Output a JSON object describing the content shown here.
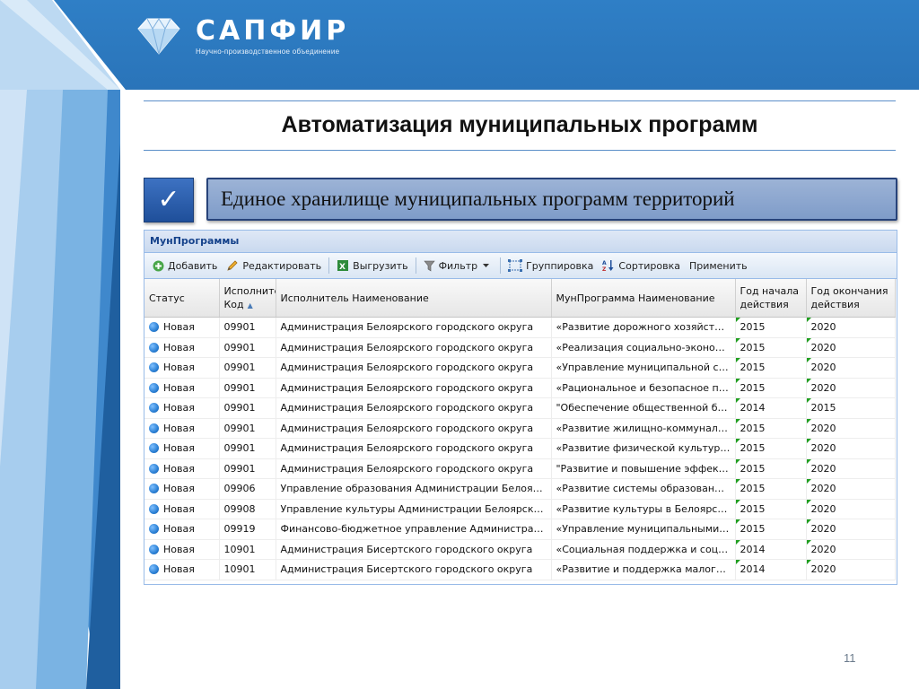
{
  "brand": {
    "name": "САПФИР",
    "subtitle": "Научно-производственное объединение"
  },
  "colors": {
    "header_blue": "#2f7fc6",
    "banner_fill": "#8fa8d0",
    "check_fill": "#2b5cab",
    "grid_header_text": "#15428b"
  },
  "slide": {
    "title": "Автоматизация муниципальных программ",
    "check_mark": "✓",
    "banner_text": "Единое хранилище муниципальных программ территорий",
    "page_number": "11"
  },
  "grid": {
    "panel_title": "МунПрограммы",
    "toolbar": {
      "add": "Добавить",
      "edit": "Редактировать",
      "export": "Выгрузить",
      "filter": "Фильтр",
      "group": "Группировка",
      "sort": "Сортировка",
      "apply": "Применить"
    },
    "columns": {
      "status": "Статус",
      "code_line1": "Исполните",
      "code_line2": "Код",
      "executor_name": "Исполнитель Наименование",
      "program_name": "МунПрограмма Наименование",
      "start_line1": "Год начала",
      "start_line2": "действия",
      "end_line1": "Год окончания",
      "end_line2": "действия"
    },
    "rows": [
      {
        "status": "Новая",
        "code": "09901",
        "executor": "Администрация Белоярского городского округа",
        "program": "«Развитие дорожного хозяйства ...",
        "start": "2015",
        "end": "2020"
      },
      {
        "status": "Новая",
        "code": "09901",
        "executor": "Администрация Белоярского городского округа",
        "program": "«Реализация социально-экономич...",
        "start": "2015",
        "end": "2020"
      },
      {
        "status": "Новая",
        "code": "09901",
        "executor": "Администрация Белоярского городского округа",
        "program": "«Управление муниципальной собс...",
        "start": "2015",
        "end": "2020"
      },
      {
        "status": "Новая",
        "code": "09901",
        "executor": "Администрация Белоярского городского округа",
        "program": "«Рациональное и безопасное при...",
        "start": "2015",
        "end": "2020"
      },
      {
        "status": "Новая",
        "code": "09901",
        "executor": "Администрация Белоярского городского округа",
        "program": "\"Обеспечение общественной без...",
        "start": "2014",
        "end": "2015"
      },
      {
        "status": "Новая",
        "code": "09901",
        "executor": "Администрация Белоярского городского округа",
        "program": "«Развитие жилищно-коммунально...",
        "start": "2015",
        "end": "2020"
      },
      {
        "status": "Новая",
        "code": "09901",
        "executor": "Администрация Белоярского городского округа",
        "program": "«Развитие физической культуры,...",
        "start": "2015",
        "end": "2020"
      },
      {
        "status": "Новая",
        "code": "09901",
        "executor": "Администрация Белоярского городского округа",
        "program": "\"Развитие и повышение эффекти...",
        "start": "2015",
        "end": "2020"
      },
      {
        "status": "Новая",
        "code": "09906",
        "executor": "Управление образования Администрации Белоярско...",
        "program": "«Развитие системы образования ...",
        "start": "2015",
        "end": "2020"
      },
      {
        "status": "Новая",
        "code": "09908",
        "executor": "Управление культуры Администрации Белоярского ...",
        "program": "«Развитие культуры в Белоярско...",
        "start": "2015",
        "end": "2020"
      },
      {
        "status": "Новая",
        "code": "09919",
        "executor": "Финансово-бюджетное управление Администрации ...",
        "program": "«Управление муниципальными фи...",
        "start": "2015",
        "end": "2020"
      },
      {
        "status": "Новая",
        "code": "10901",
        "executor": "Администрация Бисертского городского округа",
        "program": "«Социальная поддержка и социа...",
        "start": "2014",
        "end": "2020"
      },
      {
        "status": "Новая",
        "code": "10901",
        "executor": "Администрация Бисертского городского округа",
        "program": "«Развитие и поддержка малого и ...",
        "start": "2014",
        "end": "2020"
      }
    ]
  }
}
